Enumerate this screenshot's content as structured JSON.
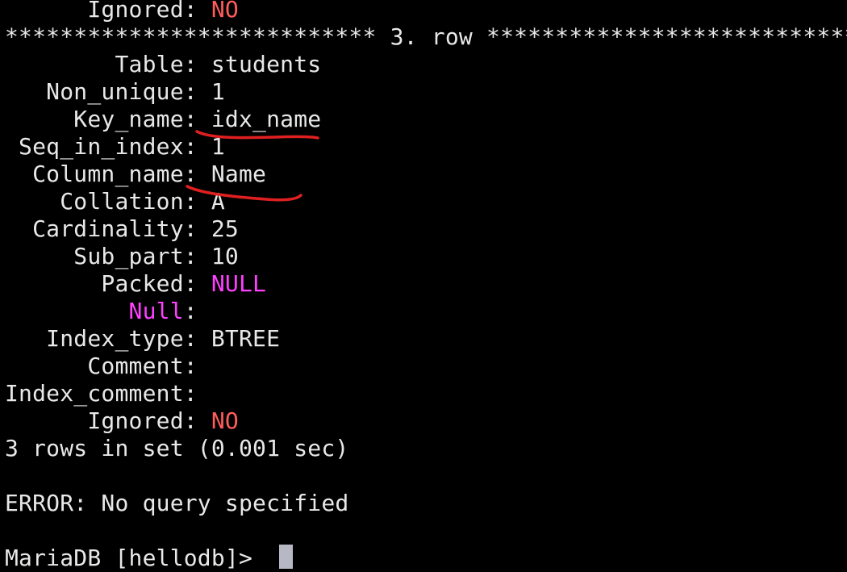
{
  "prev_row": {
    "ignored_label": "      Ignored: ",
    "ignored_value": "NO"
  },
  "row_header": "*************************** 3. row ***************************",
  "fields": {
    "table": {
      "label": "        Table: ",
      "value": "students"
    },
    "non_unique": {
      "label": "   Non_unique: ",
      "value": "1"
    },
    "key_name": {
      "label": "     Key_name: ",
      "value": "idx_name"
    },
    "seq_in_index": {
      "label": " Seq_in_index: ",
      "value": "1"
    },
    "column_name": {
      "label": "  Column_name: ",
      "value": "Name"
    },
    "collation": {
      "label": "    Collation: ",
      "value": "A"
    },
    "cardinality": {
      "label": "  Cardinality: ",
      "value": "25"
    },
    "sub_part": {
      "label": "     Sub_part: ",
      "value": "10"
    },
    "packed": {
      "label": "       Packed: ",
      "value": "NULL"
    },
    "null": {
      "indent": "         ",
      "label": "Null",
      "colon": ":",
      "value": ""
    },
    "index_type": {
      "label": "   Index_type: ",
      "value": "BTREE"
    },
    "comment": {
      "label": "      Comment:",
      "value": ""
    },
    "index_comment": {
      "label": "Index_comment:",
      "value": ""
    },
    "ignored": {
      "label": "      Ignored: ",
      "value": "NO"
    }
  },
  "result_summary": "3 rows in set (0.001 sec)",
  "error_message": "ERROR: No query specified",
  "prompt": "MariaDB [hellodb]> ",
  "colors": {
    "background": "#000000",
    "text": "#e8e8e8",
    "no_value": "#ff5c5c",
    "null_value": "#ff40ff",
    "annotation": "#e02020"
  }
}
